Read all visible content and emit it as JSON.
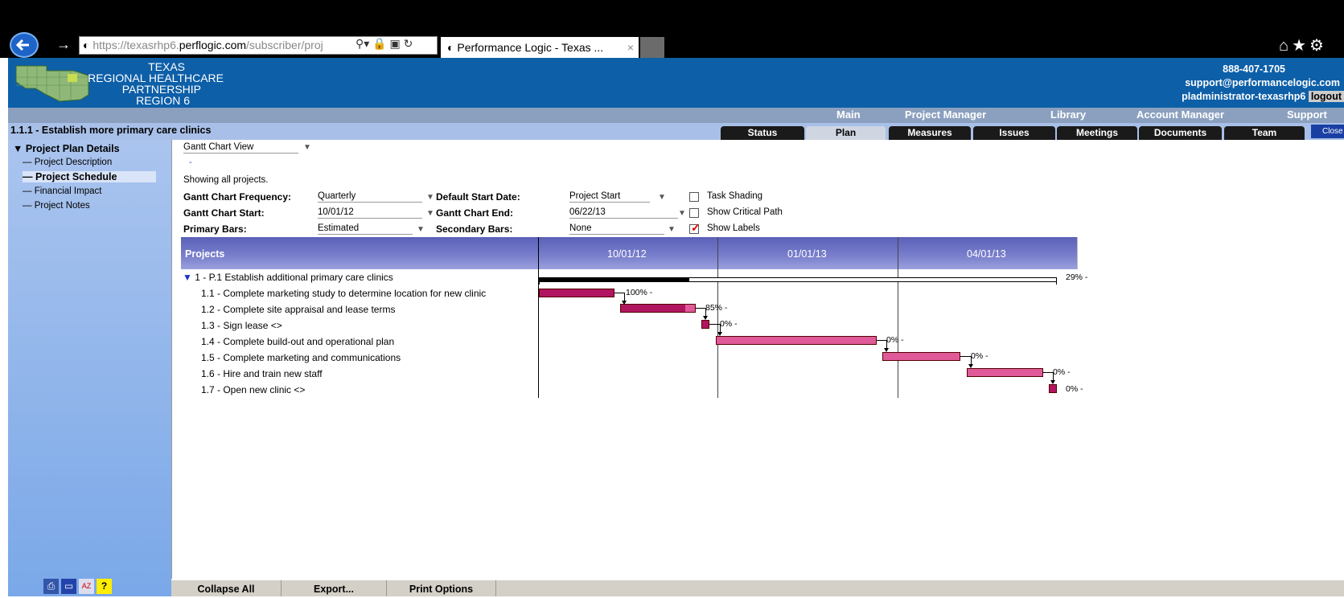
{
  "browser": {
    "url_scheme": "https://",
    "url_host_pre": "texasrhp6.",
    "url_host": "perflogic.com",
    "url_rest": "/subscriber/proj",
    "tab_title": "Performance Logic - Texas ...",
    "tab_close": "×"
  },
  "header": {
    "org_line1": "TEXAS",
    "org_line2": "REGIONAL HEALTHCARE",
    "org_line3": "PARTNERSHIP",
    "org_line4": "REGION 6",
    "phone": "888-407-1705",
    "email": "support@performancelogic.com",
    "user": "pladministrator-texasrhp6",
    "logout": "logout"
  },
  "main_nav": [
    "Main",
    "Project Manager",
    "Library",
    "Account Manager",
    "Support"
  ],
  "page_title": "1.1.1 - Establish more primary care clinics",
  "sub_tabs": [
    "Status",
    "Plan",
    "Measures",
    "Issues",
    "Meetings",
    "Documents",
    "Team"
  ],
  "active_sub_tab": "Plan",
  "close_label": "Close",
  "sidebar": {
    "heading": "Project Plan Details",
    "items": [
      "Project Description",
      "Project Schedule",
      "Financial Impact",
      "Project Notes"
    ],
    "active_item": "Project Schedule"
  },
  "view_select": "Gantt Chart View",
  "dash": "-",
  "showing_text": "Showing all projects.",
  "form": {
    "frequency_label": "Gantt Chart Frequency:",
    "frequency_value": "Quarterly",
    "default_start_label": "Default Start Date:",
    "default_start_value": "Project Start",
    "start_label": "Gantt Chart Start:",
    "start_value": "10/01/12",
    "end_label": "Gantt Chart End:",
    "end_value": "06/22/13",
    "primary_label": "Primary Bars:",
    "primary_value": "Estimated",
    "secondary_label": "Secondary Bars:",
    "secondary_value": "None",
    "task_shading": "Task Shading",
    "task_shading_checked": false,
    "critical_path": "Show Critical Path",
    "critical_path_checked": false,
    "show_labels": "Show Labels",
    "show_labels_checked": true
  },
  "gantt": {
    "projects_header": "Projects",
    "periods": [
      "10/01/12",
      "01/01/13",
      "04/01/13"
    ],
    "summary": {
      "label": "1 - P.1 Establish additional primary care clinics",
      "pct": "29% -"
    },
    "tasks": [
      {
        "label": "1.1 - Complete marketing study to determine location for new clinic",
        "pct": "100% -"
      },
      {
        "label": "1.2 - Complete site appraisal and lease terms",
        "pct": "85% -"
      },
      {
        "label": "1.3 - Sign lease <>",
        "pct": "0% -"
      },
      {
        "label": "1.4 - Complete build-out and operational plan",
        "pct": "0% -"
      },
      {
        "label": "1.5 - Complete marketing and communications",
        "pct": "0% -"
      },
      {
        "label": "1.6 - Hire and train new staff",
        "pct": "0% -"
      },
      {
        "label": "1.7 - Open new clinic <>",
        "pct": "0% -"
      }
    ]
  },
  "footer": {
    "collapse": "Collapse All",
    "export": "Export...",
    "print": "Print Options"
  },
  "icons": {
    "back": "back-arrow-icon",
    "home": "home-icon",
    "favorites": "star-icon",
    "settings": "gear-icon"
  },
  "colors": {
    "header_blue": "#0d5fa8",
    "gantt_bar": "#b01560",
    "gantt_header": "#5a60b8"
  }
}
